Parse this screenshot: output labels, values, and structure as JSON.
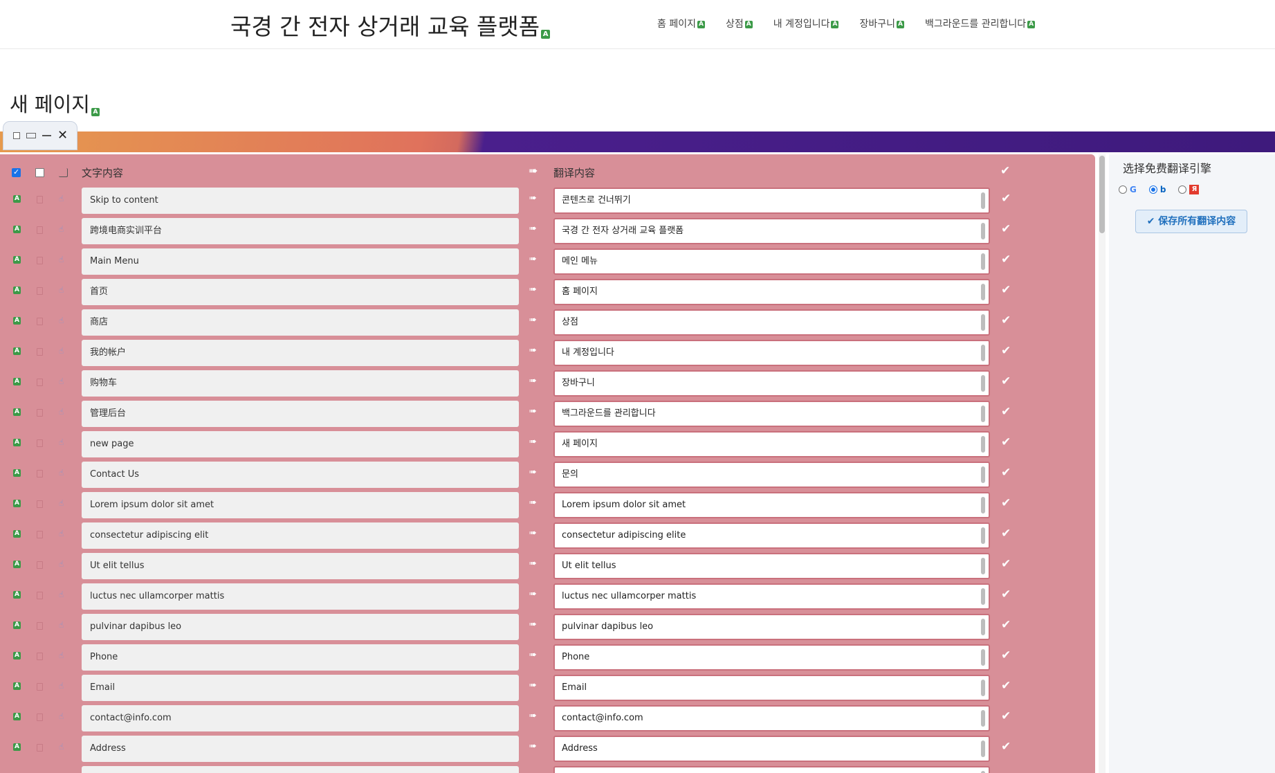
{
  "header": {
    "site_title": "국경 간 전자 상거래 교육 플랫폼",
    "nav": [
      "홈 페이지",
      "상점",
      "내 계정입니다",
      "장바구니",
      "백그라운드를 관리합니다"
    ]
  },
  "page_title": "새 페이지",
  "badge_glyph": "A",
  "window_controls": {
    "close_glyph": "✕"
  },
  "table": {
    "source_header": "文字内容",
    "target_header": "翻译内容",
    "arrow_glyph": "➠",
    "check_glyph": "✔",
    "rows": [
      {
        "source": "Skip to content",
        "target": "콘텐츠로 건너뛰기"
      },
      {
        "source": "跨境电商实训平台",
        "target": "국경 간 전자 상거래 교육 플랫폼"
      },
      {
        "source": "Main Menu",
        "target": "메인 메뉴"
      },
      {
        "source": "首页",
        "target": "홈 페이지"
      },
      {
        "source": "商店",
        "target": "상점"
      },
      {
        "source": "我的帐户",
        "target": "내 계정입니다"
      },
      {
        "source": "购物车",
        "target": "장바구니"
      },
      {
        "source": "管理后台",
        "target": "백그라운드를 관리합니다"
      },
      {
        "source": "new page",
        "target": "새 페이지"
      },
      {
        "source": "Contact Us",
        "target": "문의"
      },
      {
        "source": "Lorem ipsum dolor sit amet",
        "target": "Lorem ipsum dolor sit amet"
      },
      {
        "source": "consectetur adipiscing elit",
        "target": "consectetur adipiscing elite"
      },
      {
        "source": "Ut elit tellus",
        "target": "Ut elit tellus"
      },
      {
        "source": "luctus nec ullamcorper mattis",
        "target": "luctus nec ullamcorper mattis"
      },
      {
        "source": "pulvinar dapibus leo",
        "target": "pulvinar dapibus leo"
      },
      {
        "source": "Phone",
        "target": "Phone"
      },
      {
        "source": "Email",
        "target": "Email"
      },
      {
        "source": "contact@info.com",
        "target": "contact@info.com"
      },
      {
        "source": "Address",
        "target": "Address"
      },
      {
        "source": "",
        "target": ""
      }
    ]
  },
  "side_panel": {
    "title": "选择免费翻译引擎",
    "engines": [
      {
        "icon": "google-icon",
        "glyph": "G",
        "selected": false
      },
      {
        "icon": "bing-icon",
        "glyph": "b",
        "selected": true
      },
      {
        "icon": "yandex-icon",
        "glyph": "Я",
        "selected": false
      }
    ],
    "save_label": "✔ 保存所有翻译内容"
  },
  "colors": {
    "panel_bg": "#d88f98",
    "accent": "#1a73e8",
    "badge": "#3c9a48"
  }
}
